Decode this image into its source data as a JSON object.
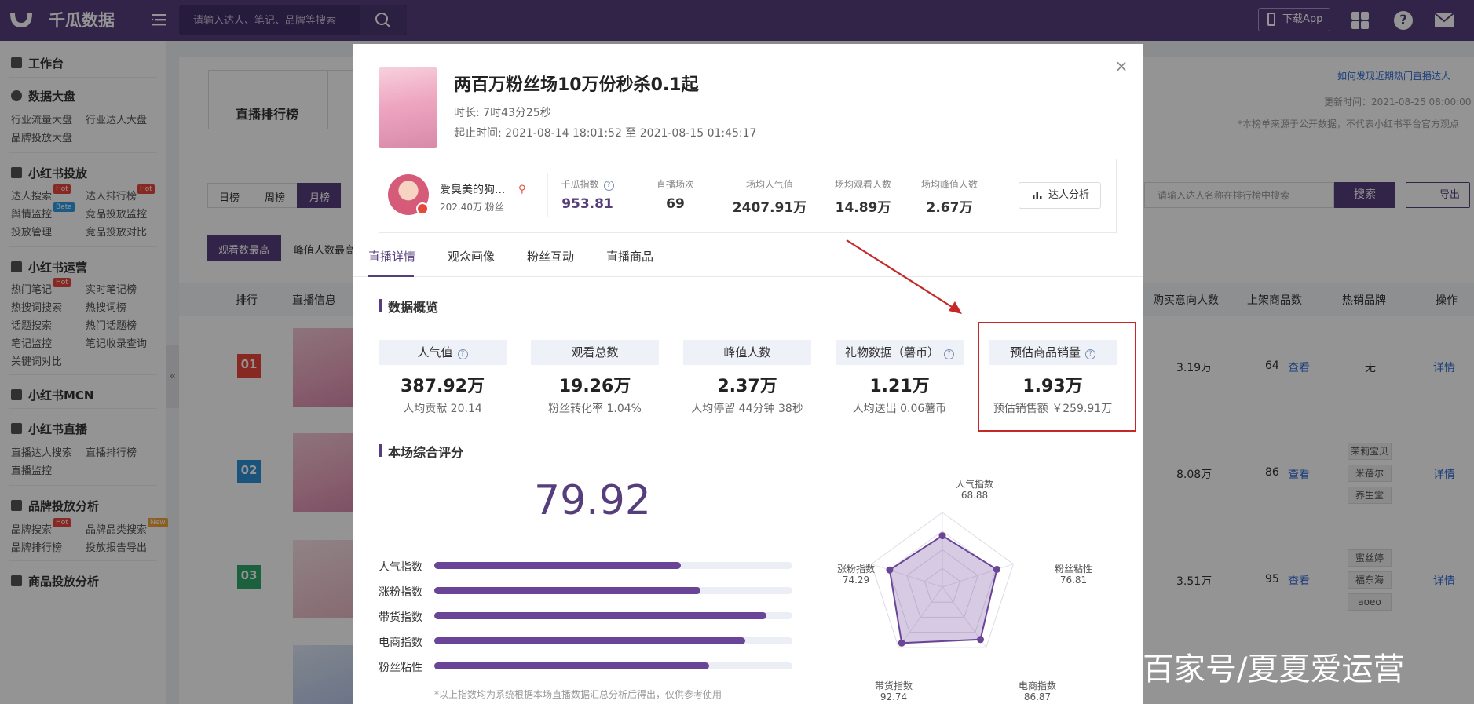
{
  "app": {
    "name": "千瓜数据"
  },
  "topbar": {
    "search_placeholder": "请输入达人、笔记、品牌等搜索",
    "download_app": "下载App"
  },
  "sidebar": {
    "sections": [
      {
        "title": "工作台",
        "items": []
      },
      {
        "title": "数据大盘",
        "items": [
          "行业流量大盘",
          "行业达人大盘",
          "品牌投放大盘"
        ]
      },
      {
        "title": "小红书投放",
        "items": [
          "达人搜索",
          "达人排行榜",
          "舆情监控",
          "竞品投放监控",
          "投放管理",
          "竞品投放对比"
        ]
      },
      {
        "title": "小红书运营",
        "items": [
          "热门笔记",
          "实时笔记榜",
          "热搜词搜索",
          "热搜词榜",
          "话题搜索",
          "热门话题榜",
          "笔记监控",
          "笔记收录查询",
          "关键词对比"
        ]
      },
      {
        "title": "小红书MCN",
        "items": []
      },
      {
        "title": "小红书直播",
        "items": [
          "直播达人搜索",
          "直播排行榜",
          "直播监控"
        ]
      },
      {
        "title": "品牌投放分析",
        "items": [
          "品牌搜索",
          "品牌品类搜索",
          "品牌排行榜",
          "投放报告导出"
        ]
      },
      {
        "title": "商品投放分析",
        "items": []
      }
    ],
    "tags": {
      "hot": "Hot",
      "beta": "Beta",
      "new": "New"
    }
  },
  "background": {
    "tab_live_rank": "直播排行榜",
    "help_link": "如何发现近期热门直播达人",
    "updated": "更新时间：2021-08-25 08:00:00",
    "disclaimer": "*本榜单来源于公开数据，不代表小红书平台官方观点",
    "period_tabs": [
      "日榜",
      "周榜",
      "月榜"
    ],
    "sort_tabs": [
      "观看数最高",
      "峰值人数最高"
    ],
    "search_placeholder": "请输入达人名称在排行榜中搜索",
    "search_btn": "搜索",
    "export_btn": "导出",
    "columns": [
      "排行",
      "直播信息",
      "购买意向人数",
      "上架商品数",
      "热销品牌",
      "操作"
    ],
    "rows": [
      {
        "rank": "01",
        "buyers": "3.19万",
        "items": "64",
        "view": "查看",
        "brands": [
          "无"
        ],
        "action": "详情"
      },
      {
        "rank": "02",
        "buyers": "8.08万",
        "items": "86",
        "view": "查看",
        "brands": [
          "茉莉宝贝",
          "米蓓尔",
          "养生堂"
        ],
        "action": "详情"
      },
      {
        "rank": "03",
        "buyers": "3.51万",
        "items": "95",
        "view": "查看",
        "brands": [
          "蜜丝婷",
          "福东海",
          "aoeo"
        ],
        "action": "详情"
      }
    ]
  },
  "modal": {
    "title": "两百万粉丝场10万份秒杀0.1起",
    "duration": "时长: 7时43分25秒",
    "period": "起止时间:  2021-08-14 18:01:52 至 2021-08-15 01:45:17",
    "user": {
      "name": "爱臭美的狗...",
      "fans": "202.40万 粉丝"
    },
    "stats": [
      {
        "label": "千瓜指数",
        "value": "953.81"
      },
      {
        "label": "直播场次",
        "value": "69"
      },
      {
        "label": "场均人气值",
        "value": "2407.91万"
      },
      {
        "label": "场均观看人数",
        "value": "14.89万"
      },
      {
        "label": "场均峰值人数",
        "value": "2.67万"
      }
    ],
    "analysis_btn": "达人分析",
    "tabs": [
      "直播详情",
      "观众画像",
      "粉丝互动",
      "直播商品"
    ],
    "overview_title": "数据概览",
    "cards": [
      {
        "label": "人气值",
        "value": "387.92万",
        "sub": "人均贡献 20.14"
      },
      {
        "label": "观看总数",
        "value": "19.26万",
        "sub": "粉丝转化率 1.04%"
      },
      {
        "label": "峰值人数",
        "value": "2.37万",
        "sub": "人均停留 44分钟 38秒"
      },
      {
        "label": "礼物数据（薯币）",
        "value": "1.21万",
        "sub": "人均送出 0.06薯币"
      },
      {
        "label": "预估商品销量",
        "value": "1.93万",
        "sub": "预估销售额 ￥259.91万"
      }
    ],
    "score_title": "本场综合评分",
    "score": "79.92",
    "bars": [
      {
        "label": "人气指数",
        "value": 68.88
      },
      {
        "label": "涨粉指数",
        "value": 74.29
      },
      {
        "label": "带货指数",
        "value": 92.74
      },
      {
        "label": "电商指数",
        "value": 86.87
      },
      {
        "label": "粉丝粘性",
        "value": 76.81
      }
    ],
    "radar": [
      {
        "label": "人气指数",
        "value": "68.88"
      },
      {
        "label": "粉丝粘性",
        "value": "76.81"
      },
      {
        "label": "电商指数",
        "value": "86.87"
      },
      {
        "label": "带货指数",
        "value": "92.74"
      },
      {
        "label": "涨粉指数",
        "value": "74.29"
      }
    ],
    "footnote": "*以上指数均为系统根据本场直播数据汇总分析后得出，仅供参考使用"
  },
  "watermark": "百家号/夏夏爱运营",
  "colors": {
    "brand": "#563d7c",
    "highlight": "#c62828"
  }
}
